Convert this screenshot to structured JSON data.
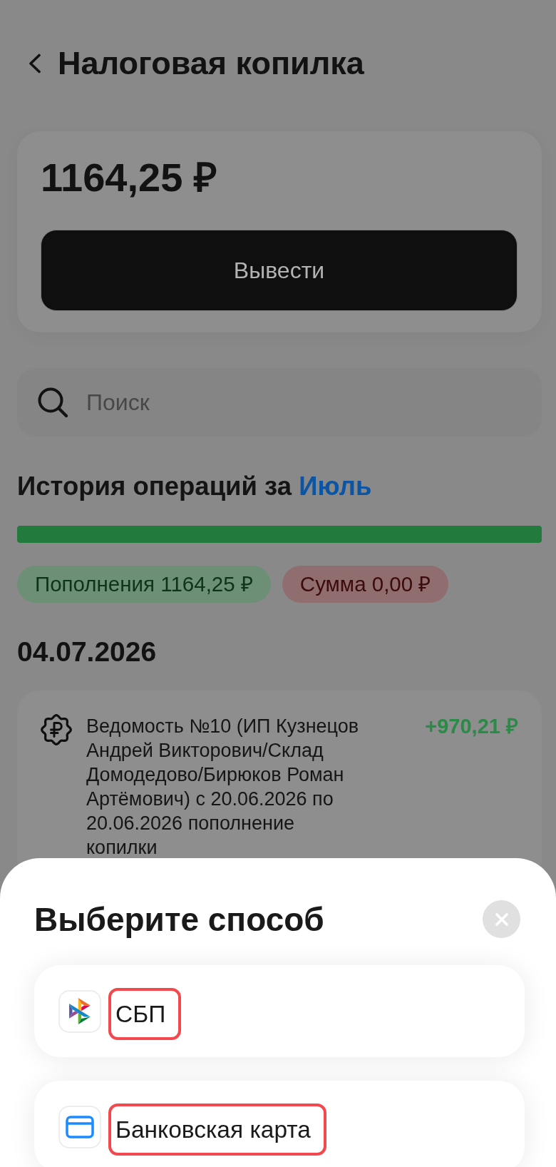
{
  "header": {
    "title": "Налоговая копилка"
  },
  "balance": {
    "amount": "1164,25 ₽",
    "button": "Вывести"
  },
  "search": {
    "placeholder": "Поиск"
  },
  "history": {
    "title": "История операций за",
    "month": "Июль",
    "progress": {
      "level": 1
    },
    "chips": [
      {
        "kind": "income",
        "label": "Пополнения 1164,25 ₽"
      },
      {
        "kind": "expense",
        "label": "Сумма 0,00 ₽"
      }
    ]
  },
  "days": [
    {
      "date": "04.07.2026",
      "operations": [
        {
          "kind": "deposit",
          "description": "Ведомость №10 (ИП Кузнецов Андрей Викторович/Склад Домодедово/Бирюков Роман Артёмович) с 20.06.2026 по 20.06.2026 пополнение копилки",
          "amount": "+970,21 ₽"
        }
      ]
    }
  ],
  "sheet": {
    "title": "Выберите способ",
    "options": [
      {
        "kind": "sbp",
        "label": "СБП",
        "highlighted": true
      },
      {
        "kind": "card",
        "label": "Банковская карта",
        "highlighted": true
      }
    ]
  }
}
